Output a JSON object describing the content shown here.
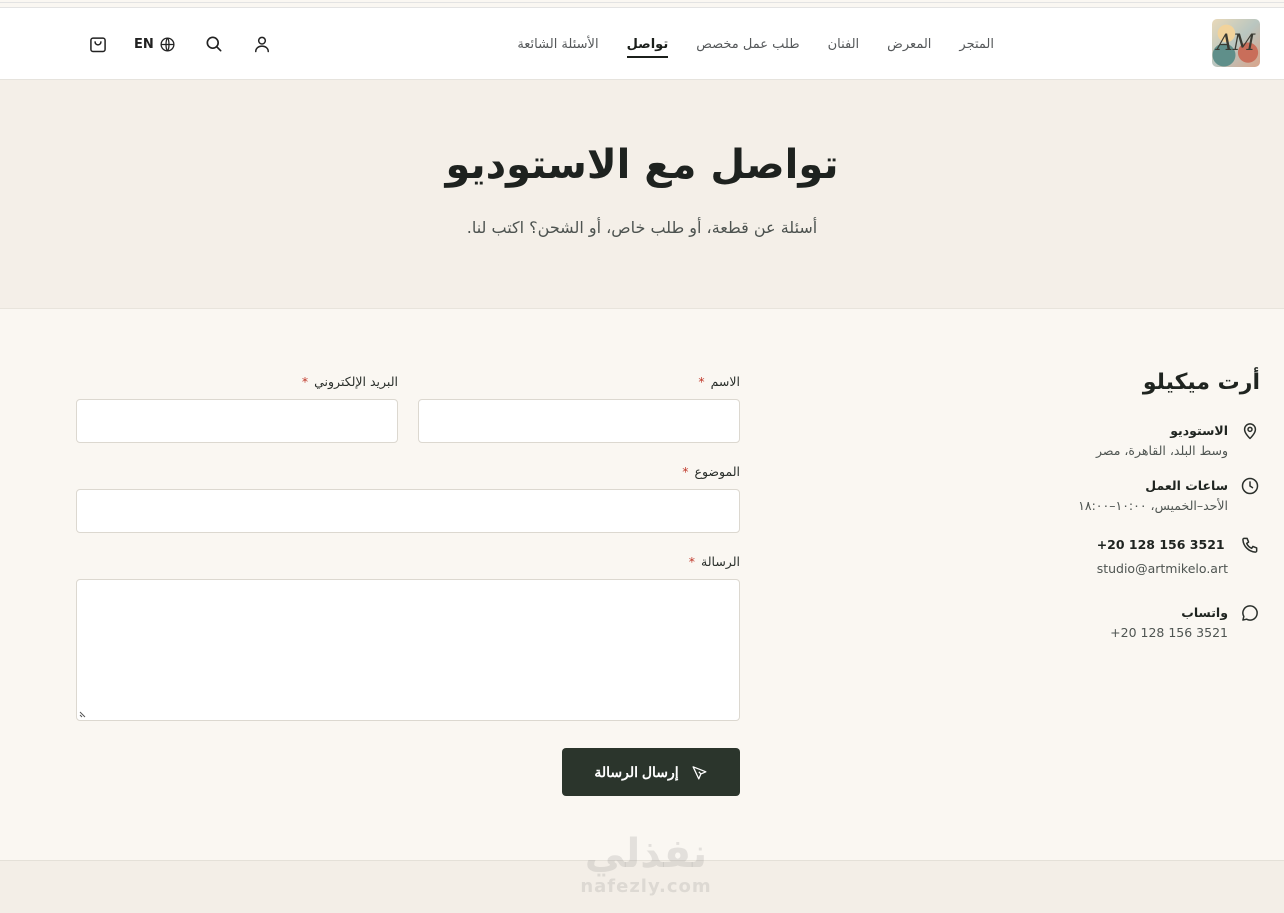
{
  "nav": {
    "logo_alt": "Art Mikelo logo",
    "items": [
      {
        "label": "المتجر",
        "active": false
      },
      {
        "label": "المعرض",
        "active": false
      },
      {
        "label": "الفنان",
        "active": false
      },
      {
        "label": "طلب عمل مخصص",
        "active": false
      },
      {
        "label": "تواصل",
        "active": true
      },
      {
        "label": "الأسئلة الشائعة",
        "active": false
      }
    ],
    "language_label": "EN",
    "icons": {
      "account": "user-icon",
      "search": "search-icon",
      "language": "globe-icon",
      "cart": "shopping-bag-icon"
    }
  },
  "hero": {
    "title": "تواصل مع الاستوديو",
    "subtitle": "أسئلة عن قطعة، أو طلب خاص، أو الشحن؟ اكتب لنا."
  },
  "studio_info": {
    "name": "أرت ميكيلو",
    "location": {
      "title": "الاستوديو",
      "value": "وسط البلد، القاهرة، مصر",
      "icon": "map-pin-icon"
    },
    "hours": {
      "title": "ساعات العمل",
      "value": "الأحد–الخميس، ١٠:٠٠–١٨:٠٠",
      "icon": "clock-icon"
    },
    "contact": {
      "phone": "+20 128 156 3521",
      "email": "studio@artmikelo.art",
      "icon": "phone-icon"
    },
    "whatsapp": {
      "title": "واتساب",
      "value": "+20 128 156 3521",
      "icon": "chat-bubble-icon"
    }
  },
  "form": {
    "required_mark": "*",
    "name_label": "الاسم",
    "email_label": "البريد الإلكتروني",
    "subject_label": "الموضوع",
    "message_label": "الرسالة",
    "name_value": "",
    "email_value": "",
    "subject_value": "",
    "message_value": "",
    "submit_label": "إرسال الرسالة",
    "submit_icon": "send-icon"
  },
  "watermark": {
    "arabic": "نفذلي",
    "latin": "nafezly.com"
  },
  "colors": {
    "primary_button": "#2b352c",
    "hero_background": "#f4efe8",
    "page_background": "#faf7f2",
    "required": "#c0392b"
  }
}
